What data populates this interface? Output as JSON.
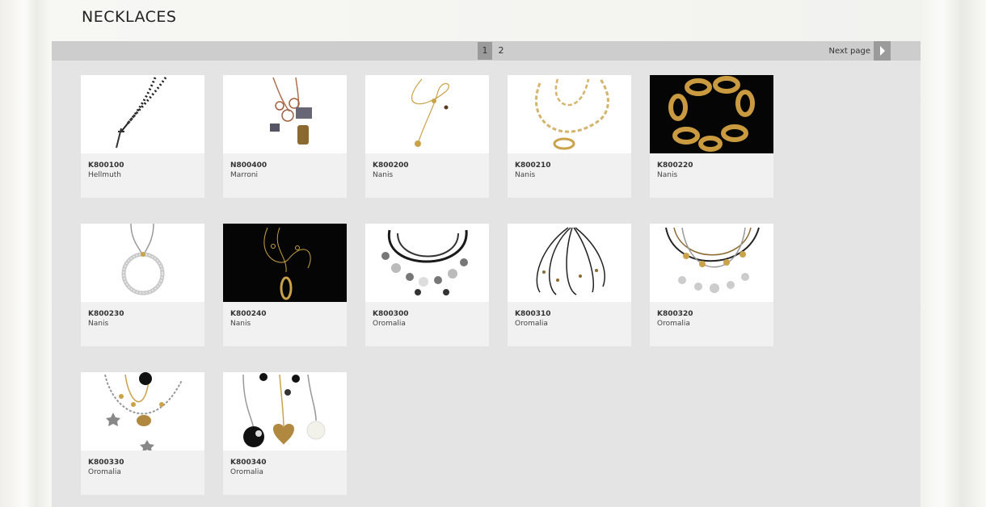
{
  "page": {
    "title": "NECKLACES"
  },
  "pagination": {
    "pages": [
      "1",
      "2"
    ],
    "current": "1",
    "next_label": "Next page"
  },
  "products": [
    {
      "code": "K800100",
      "brand": "Hellmuth"
    },
    {
      "code": "N800400",
      "brand": "Marroni"
    },
    {
      "code": "K800200",
      "brand": "Nanis"
    },
    {
      "code": "K800210",
      "brand": "Nanis"
    },
    {
      "code": "K800220",
      "brand": "Nanis"
    },
    {
      "code": "K800230",
      "brand": "Nanis"
    },
    {
      "code": "K800240",
      "brand": "Nanis"
    },
    {
      "code": "K800300",
      "brand": "Oromalia"
    },
    {
      "code": "K800310",
      "brand": "Oromalia"
    },
    {
      "code": "K800320",
      "brand": "Oromalia"
    },
    {
      "code": "K800330",
      "brand": "Oromalia"
    },
    {
      "code": "K800340",
      "brand": "Oromalia"
    }
  ],
  "colors": {
    "panel": "#e4e4e4",
    "pager_bar": "#cdcdcd",
    "active_page": "#9b9b9b",
    "card": "#f1f1f1",
    "gold": "#c9a24a"
  }
}
